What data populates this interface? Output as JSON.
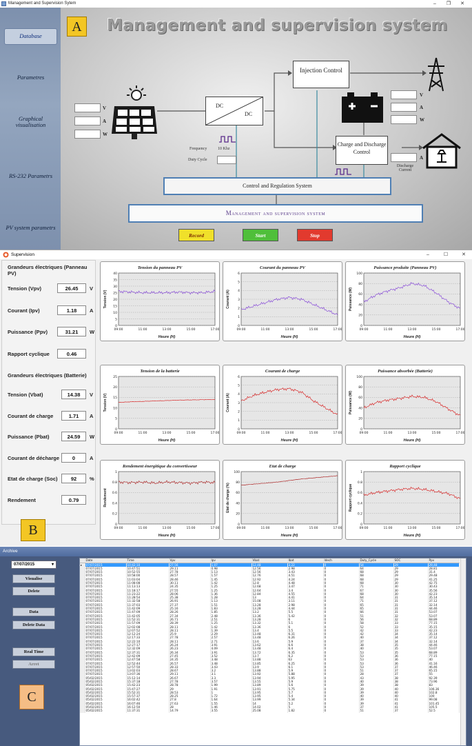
{
  "panelA": {
    "window_title": "Management and Supervision Sytem",
    "window_controls": [
      "–",
      "❐",
      "✕"
    ],
    "label": "A",
    "title": "Management and supervision system",
    "sidebar": [
      {
        "label": "Database"
      },
      {
        "label": "Parametres"
      },
      {
        "label": "Graphical visualisation"
      },
      {
        "label": "RS-232 Parametrs"
      },
      {
        "label": "PV system parametrs"
      }
    ],
    "pv_units": [
      "V",
      "A",
      "W"
    ],
    "battery_units": [
      "V",
      "A",
      "W"
    ],
    "dc_left": "DC",
    "dc_right": "DC",
    "frequency_label": "Frequency",
    "frequency_value": "10 Khz",
    "duty_cycle_label": "Duty Cycle",
    "injection_control": "Injection Control",
    "charge_control": "Charge and Discharge Control",
    "discharge_current": "Discharge Current",
    "discharge_unit": "A",
    "control_regulation": "Control and Regulation System",
    "management_label": "Management and supervision system",
    "buttons": [
      {
        "label": "Record",
        "color": "#f0e02a"
      },
      {
        "label": "Start",
        "color": "#4fbf3a"
      },
      {
        "label": "Stop",
        "color": "#e23a2e"
      }
    ]
  },
  "panelB": {
    "window_title": "Supervision",
    "window_controls": [
      "–",
      "☐",
      "✕"
    ],
    "label": "B",
    "pv_group_title": "Grandeurs électriques (Panneau PV)",
    "pv_params": [
      {
        "label": "Tension (Vpv)",
        "value": "26.45",
        "unit": "V"
      },
      {
        "label": "Courant (Ipv)",
        "value": "1.18",
        "unit": "A"
      },
      {
        "label": "Puissance (Ppv)",
        "value": "31.21",
        "unit": "W"
      },
      {
        "label": "Rapport cyclique",
        "value": "0.46",
        "unit": ""
      }
    ],
    "battery_group_title": "Grandeurs électriques (Batterie)",
    "battery_params": [
      {
        "label": "Tension (Vbat)",
        "value": "14.38",
        "unit": "V"
      },
      {
        "label": "Courant de charge",
        "value": "1.71",
        "unit": "A"
      },
      {
        "label": "Puissance (Pbat)",
        "value": "24.59",
        "unit": "W"
      },
      {
        "label": "Courant de décharge",
        "value": "0",
        "unit": "A"
      },
      {
        "label": "Etat de charge (Soc)",
        "value": "92",
        "unit": "%"
      },
      {
        "label": "Rendement",
        "value": "0.79",
        "unit": ""
      }
    ]
  },
  "chart_data": [
    {
      "type": "line",
      "title": "Tension du panneau PV",
      "ylabel": "Tension (V)",
      "xlabel": "Heure (H)",
      "xticks": [
        "09:00",
        "11:00",
        "13:00",
        "15:00",
        "17:00"
      ],
      "yticks": [
        0,
        5,
        10,
        15,
        20,
        25,
        30,
        35,
        40
      ],
      "ylim": [
        0,
        40
      ],
      "color": "#8a4fd8",
      "x": [
        9,
        10,
        11,
        12,
        13,
        14,
        15,
        16,
        17
      ],
      "y": [
        26,
        25.5,
        25,
        25,
        25,
        25.5,
        25,
        25,
        26
      ]
    },
    {
      "type": "line",
      "title": "Courant du panneau PV",
      "ylabel": "Courant (A)",
      "xlabel": "Heure (H)",
      "xticks": [
        "09:00",
        "11:00",
        "13:00",
        "15:00",
        "17:00"
      ],
      "yticks": [
        0,
        1,
        2,
        3,
        4,
        5,
        6
      ],
      "ylim": [
        0,
        6
      ],
      "color": "#8a4fd8",
      "x": [
        9,
        10,
        11,
        12,
        13,
        14,
        15,
        16,
        17
      ],
      "y": [
        1.8,
        2.2,
        2.6,
        3.0,
        3.2,
        3.0,
        2.4,
        1.8,
        1.2
      ]
    },
    {
      "type": "line",
      "title": "Puissance produite (Panneau PV)",
      "ylabel": "Puissance (W)",
      "xlabel": "Heure (H)",
      "xticks": [
        "09:00",
        "11:00",
        "13:00",
        "15:00",
        "17:00"
      ],
      "yticks": [
        0,
        20,
        40,
        60,
        80,
        100
      ],
      "ylim": [
        0,
        100
      ],
      "color": "#8a4fd8",
      "x": [
        9,
        10,
        11,
        12,
        13,
        14,
        15,
        16,
        17
      ],
      "y": [
        45,
        58,
        66,
        72,
        80,
        76,
        62,
        45,
        32
      ]
    },
    {
      "type": "line",
      "title": "Tension de la batterie",
      "ylabel": "Tension (V)",
      "xlabel": "Heure (H)",
      "xticks": [
        "09:00",
        "11:00",
        "13:00",
        "15:00",
        "17:00"
      ],
      "yticks": [
        0,
        5,
        10,
        15,
        20,
        25
      ],
      "ylim": [
        0,
        25
      ],
      "color": "#d82a2a",
      "x": [
        9,
        10,
        11,
        12,
        13,
        14,
        15,
        16,
        17
      ],
      "y": [
        12.6,
        12.9,
        13.1,
        13.3,
        13.5,
        13.7,
        13.8,
        13.9,
        14.0
      ]
    },
    {
      "type": "line",
      "title": "Courant de charge",
      "ylabel": "Courant (A)",
      "xlabel": "Heure (H)",
      "xticks": [
        "09:00",
        "11:00",
        "13:00",
        "15:00",
        "17:00"
      ],
      "yticks": [
        0,
        1,
        2,
        3,
        4,
        5,
        6
      ],
      "ylim": [
        0,
        6
      ],
      "color": "#d82a2a",
      "x": [
        9,
        10,
        11,
        12,
        13,
        14,
        15,
        16,
        17
      ],
      "y": [
        3.2,
        3.8,
        4.2,
        4.5,
        4.6,
        4.2,
        3.2,
        2.4,
        1.6
      ]
    },
    {
      "type": "line",
      "title": "Puissance absorbée (Batterie)",
      "ylabel": "Puissance (W)",
      "xlabel": "Heure (H)",
      "xticks": [
        "09:00",
        "11:00",
        "13:00",
        "15:00",
        "17:00"
      ],
      "yticks": [
        0,
        20,
        40,
        60,
        80,
        100
      ],
      "ylim": [
        0,
        100
      ],
      "color": "#d82a2a",
      "x": [
        9,
        10,
        11,
        12,
        13,
        14,
        15,
        16,
        17
      ],
      "y": [
        40,
        50,
        55,
        58,
        62,
        60,
        52,
        38,
        25
      ]
    },
    {
      "type": "line",
      "title": "Rendement énergitique du convertisseur",
      "ylabel": "Rendement",
      "xlabel": "Heure (H)",
      "xticks": [
        "09:00",
        "11:00",
        "13:00",
        "15:00",
        "17:00"
      ],
      "yticks": [
        0,
        0.2,
        0.4,
        0.6,
        0.8,
        1.0
      ],
      "ylim": [
        0,
        1
      ],
      "color": "#b03030",
      "x": [
        9,
        10,
        11,
        12,
        13,
        14,
        15,
        16,
        17
      ],
      "y": [
        0.8,
        0.79,
        0.8,
        0.78,
        0.8,
        0.79,
        0.78,
        0.8,
        0.79
      ]
    },
    {
      "type": "line",
      "title": "Etat de charge",
      "ylabel": "Etat de charge (%)",
      "xlabel": "Heure (H)",
      "xticks": [
        "09:00",
        "11:00",
        "13:00",
        "15:00",
        "17:00"
      ],
      "yticks": [
        0,
        20,
        40,
        60,
        80,
        100
      ],
      "ylim": [
        0,
        100
      ],
      "color": "#b03030",
      "x": [
        9,
        10,
        11,
        12,
        13,
        14,
        15,
        16,
        17
      ],
      "y": [
        74,
        76,
        78,
        80,
        83,
        86,
        88,
        90,
        92
      ]
    },
    {
      "type": "line",
      "title": "Rapport cyclique",
      "ylabel": "Rapport cyclique",
      "xlabel": "Heure (H)",
      "xticks": [
        "09:00",
        "11:00",
        "13:00",
        "15:00",
        "17:00"
      ],
      "yticks": [
        0,
        0.2,
        0.4,
        0.6,
        0.8,
        1.0
      ],
      "ylim": [
        0,
        1
      ],
      "color": "#d82a2a",
      "x": [
        9,
        10,
        11,
        12,
        13,
        14,
        15,
        16,
        17
      ],
      "y": [
        0.55,
        0.6,
        0.63,
        0.66,
        0.68,
        0.66,
        0.62,
        0.58,
        0.48
      ]
    }
  ],
  "panelC": {
    "window_title": "Archive",
    "label": "C",
    "date_select": "07/07/2015",
    "buttons": [
      "Visualise",
      "Delete",
      "Data",
      "Delete Data",
      "Real Time",
      "Arret"
    ],
    "columns": [
      "Date",
      "Time",
      "Vpv",
      "Ipv",
      "Vbat",
      "Ibat",
      "Idech",
      "Duty_Cycle",
      "SOC",
      "Ppv"
    ],
    "rows": [
      [
        "07/07/2015",
        "10:42:10",
        "27.56",
        "1.07",
        "12.48",
        "3.22",
        "0",
        "54",
        "29",
        "29.48"
      ],
      [
        "07/07/2015",
        "10:47:51",
        "29.11",
        "0.98",
        "12.56",
        "2.98",
        "0",
        "64",
        "29",
        "28.81"
      ],
      [
        "07/07/2015",
        "10:52:55",
        "27.78",
        "1.13",
        "12.56",
        "3.43",
        "0",
        "68",
        "29",
        "31.4"
      ],
      [
        "07/07/2015",
        "10:58:00",
        "28.57",
        "1.57",
        "12.76",
        "4.51",
        "0",
        "68",
        "29",
        "29.48"
      ],
      [
        "07/07/2015",
        "11:03:04",
        "28.46",
        "1.45",
        "12.92",
        "4.24",
        "0",
        "68",
        "29",
        "41.25"
      ],
      [
        "07/07/2015",
        "11:08:08",
        "30.11",
        "1.42",
        "12.8",
        "4.48",
        "0",
        "68",
        "30",
        "42.75"
      ],
      [
        "07/07/2015",
        "11:13:13",
        "24.35",
        "1.25",
        "12.68",
        "3.47",
        "0",
        "71",
        "30",
        "30.43"
      ],
      [
        "07/07/2015",
        "11:18:17",
        "27.55",
        "1.25",
        "12.64",
        "3.4",
        "0",
        "67",
        "30",
        "35.56"
      ],
      [
        "07/07/2015",
        "11:23:22",
        "28.06",
        "1.36",
        "12.84",
        "4.55",
        "0",
        "68",
        "30",
        "42.23"
      ],
      [
        "07/07/2015",
        "11:28:54",
        "25.38",
        "1.28",
        "13",
        "4.41",
        "0",
        "64",
        "31",
        "35.14"
      ],
      [
        "07/07/2015",
        "11:32:58",
        "26.91",
        "1.13",
        "15.08",
        "3.11",
        "0",
        "71",
        "31",
        "37.12"
      ],
      [
        "07/07/2015",
        "11:37:03",
        "27.37",
        "1.51",
        "13.28",
        "2.98",
        "0",
        "65",
        "31",
        "32.14"
      ],
      [
        "07/07/2015",
        "11:42:09",
        "25.16",
        "1.83",
        "13.28",
        "4.44",
        "0",
        "65",
        "31",
        "44.46"
      ],
      [
        "07/07/2015",
        "11:47:09",
        "28.26",
        "1.85",
        "13.2",
        "5.5",
        "0",
        "66",
        "31",
        "53.07"
      ],
      [
        "07/07/2015",
        "11:42:05",
        "27.34",
        "2.48",
        "13.36",
        "5.42",
        "0",
        "51",
        "32",
        "53.07"
      ],
      [
        "07/07/2015",
        "11:52:31",
        "26.71",
        "2.51",
        "13.28",
        "6",
        "0",
        "56",
        "32",
        "68.89"
      ],
      [
        "07/07/2015",
        "11:57:09",
        "28.39",
        "1.25",
        "13.32",
        "5.1",
        "0",
        "58",
        "33",
        "77.15"
      ],
      [
        "07/07/2015",
        "12:02:08",
        "28.11",
        "1.42",
        "13.36",
        "6",
        "0",
        "52",
        "33",
        "35.15"
      ],
      [
        "07/07/2015",
        "12:07:52",
        "28.11",
        "1.39",
        "13.4",
        "5.5",
        "0",
        "42",
        "33",
        "42.23"
      ],
      [
        "07/07/2015",
        "12:12:24",
        "25.9",
        "2.29",
        "13.48",
        "6.31",
        "0",
        "42",
        "34",
        "35.14"
      ],
      [
        "07/07/2015",
        "12:17:33",
        "27.78",
        "2.57",
        "13.48",
        "6.26",
        "0",
        "40",
        "34",
        "37.12"
      ],
      [
        "07/07/2015",
        "12:22:10",
        "28.11",
        "2.71",
        "13.6",
        "5.9",
        "0",
        "37",
        "34",
        "32.14"
      ],
      [
        "07/07/2015",
        "12:27:17",
        "26.24",
        "3.91",
        "13.62",
        "6.6",
        "0",
        "38",
        "35",
        "44.46"
      ],
      [
        "07/07/2015",
        "12:32:09",
        "26.23",
        "4.09",
        "13.48",
        "6.4",
        "0",
        "40",
        "35",
        "53.07"
      ],
      [
        "07/07/2015",
        "12:37:31",
        "26.34",
        "3.91",
        "13.72",
        "6.35",
        "0",
        "53",
        "35",
        "68.89"
      ],
      [
        "07/07/2015",
        "12:42:09",
        "27.45",
        "3.52",
        "13.7",
        "6.2",
        "0",
        "53",
        "36",
        "77.15"
      ],
      [
        "07/07/2015",
        "12:47:58",
        "24.35",
        "3.48",
        "13.88",
        "63",
        "0",
        "53",
        "36",
        "40"
      ],
      [
        "07/07/2015",
        "12:52:44",
        "26.57",
        "3.48",
        "13.85",
        "6.25",
        "0",
        "53",
        "36",
        "41.16"
      ],
      [
        "07/07/2015",
        "12:57:50",
        "28.33",
        "3.43",
        "13.9",
        "6.1",
        "0",
        "53",
        "37",
        "46.46"
      ],
      [
        "07/07/2015",
        "13:02:03",
        "28.67",
        "3.2",
        "13.88",
        "5.9",
        "0",
        "51",
        "37",
        "65.15"
      ],
      [
        "07/07/2015",
        "13:07:36",
        "29.11",
        "3.1",
        "13.92",
        "5.88",
        "0",
        "28",
        "37",
        "55"
      ],
      [
        "05/02/2015",
        "15:12:14",
        "26.67",
        "3.3",
        "13.94",
        "5.95",
        "0",
        "43",
        "38",
        "92.39"
      ],
      [
        "05/02/2015",
        "15:37:18",
        "27.78",
        "3.57",
        "13.55",
        "5.9",
        "0",
        "40",
        "38",
        "73.96"
      ],
      [
        "05/02/2015",
        "15:42:23",
        "28.78",
        "1.99",
        "13.89",
        "5.6",
        "0",
        "39",
        "38",
        "83"
      ],
      [
        "05/02/2015",
        "15:47:27",
        "29",
        "1.91",
        "13.91",
        "5.75",
        "0",
        "39",
        "40",
        "106.36"
      ],
      [
        "05/02/2015",
        "15:52:31",
        "28.53",
        "1",
        "13.95",
        "5.7",
        "0",
        "39",
        "40",
        "102.8"
      ],
      [
        "05/02/2015",
        "15:57:37",
        "28.25",
        "1.72",
        "13.95",
        "5.4",
        "0",
        "40",
        "40",
        "100"
      ],
      [
        "05/02/2015",
        "16:02:42",
        "27.8",
        "1.64",
        "13.99",
        "5.34",
        "0",
        "39",
        "41",
        "99.08"
      ],
      [
        "05/02/2015",
        "16:07:46",
        "27.63",
        "1.55",
        "14",
        "5.2",
        "0",
        "39",
        "41",
        "101.45"
      ],
      [
        "05/02/2015",
        "16:12:50",
        "28",
        "1.46",
        "14.02",
        "5",
        "0",
        "37",
        "41",
        "105.5"
      ],
      [
        "05/02/2015",
        "11:37:31",
        "14.79",
        "3.55",
        "25.08",
        "1.82",
        "0",
        "51",
        "37",
        "52.5"
      ]
    ]
  }
}
